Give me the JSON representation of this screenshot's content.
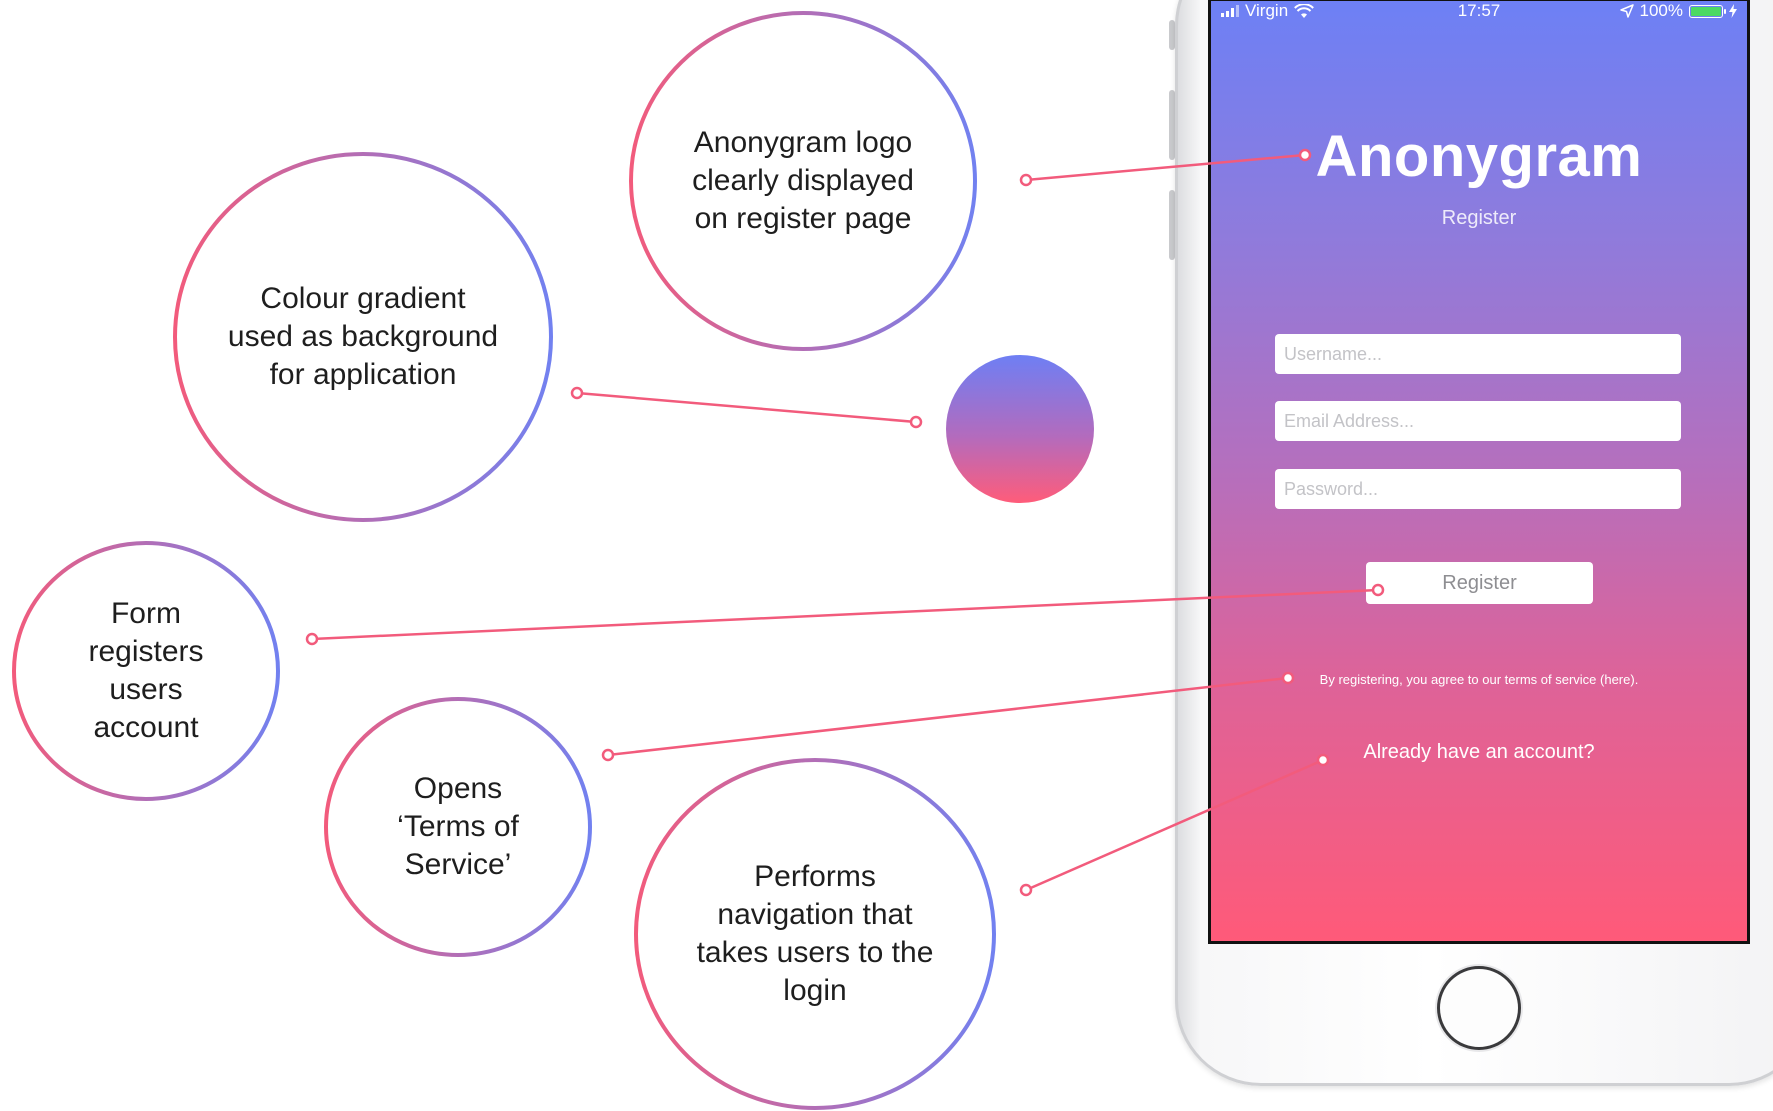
{
  "annotations": {
    "logo": "Anonygram logo\nclearly displayed\non register page",
    "gradient": "Colour gradient\nused as background\nfor application",
    "form": "Form\nregisters\nusers\naccount",
    "terms": "Opens\n‘Terms of\nService’",
    "login": "Performs\nnavigation that\ntakes users to the\nlogin"
  },
  "colors": {
    "gradient_top": "#6d80f5",
    "gradient_bottom": "#ff5a79",
    "connector": "#f25b7c",
    "battery": "#4cd964"
  },
  "status_bar": {
    "carrier": "Virgin",
    "time": "17:57",
    "battery": "100%",
    "battery_level": 1.0,
    "icons": [
      "signal-icon",
      "wifi-icon",
      "location-icon",
      "battery-icon",
      "charging-icon"
    ]
  },
  "app": {
    "title": "Anonygram",
    "subtitle": "Register",
    "username_placeholder": "Username...",
    "email_placeholder": "Email Address...",
    "password_placeholder": "Password...",
    "register_label": "Register",
    "terms_text": "By registering, you agree to our terms of service (here).",
    "login_link": "Already have an account?"
  }
}
